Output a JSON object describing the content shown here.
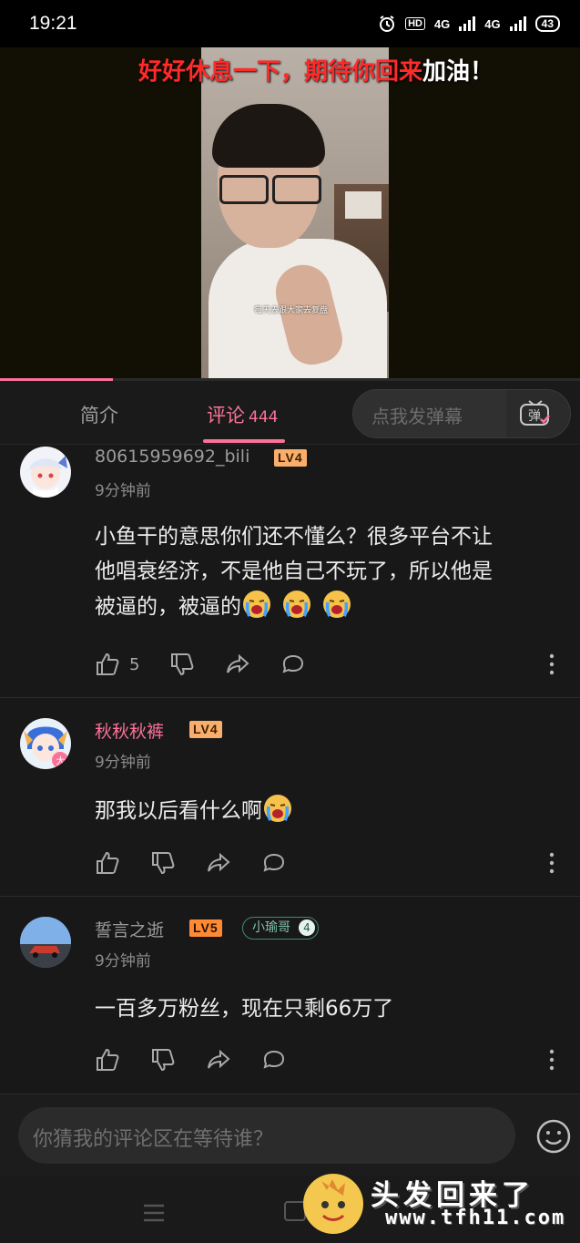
{
  "status_bar": {
    "time": "19:21",
    "hd": "HD",
    "net1": "4G",
    "net2": "4G",
    "battery": "43"
  },
  "video": {
    "danmaku_red": "好好休息一下，期待你回来",
    "danmaku_white": "加油！",
    "subtitle": "每天去跟大家去复盘",
    "progress": 0.195
  },
  "tabs": {
    "intro": "简介",
    "comments": "评论",
    "comment_count": "444",
    "danmaku_placeholder": "点我发弹幕",
    "danmaku_toggle_label": "弹"
  },
  "comments": [
    {
      "username": "80615959692_bili",
      "level": "LV4",
      "time": "9分钟前",
      "text_lines": [
        "小鱼干的意思你们还不懂么？很多平台不让",
        "他唱衰经济，不是他自己不玩了，所以他是",
        "被逼的，被逼的"
      ],
      "emojis": [
        "crying-emoji",
        "crying-emoji",
        "crying-emoji"
      ],
      "likes": "5"
    },
    {
      "username": "秋秋秋裤",
      "level": "LV4",
      "time": "9分钟前",
      "text_lines": [
        "那我以后看什么啊"
      ],
      "emojis": [
        "crying-emoji"
      ],
      "likes": ""
    },
    {
      "username": "誓言之逝",
      "level": "LV5",
      "fan_badge": "小瑜哥",
      "fan_level": "4",
      "time": "9分钟前",
      "text_lines": [
        "一百多万粉丝，现在只剩66万了"
      ],
      "likes": ""
    }
  ],
  "reply": {
    "placeholder": "你猜我的评论区在等待谁？"
  },
  "watermark": {
    "text": "头发回来了",
    "url": "www.tfh11.com"
  },
  "colors": {
    "accent": "#fb7299",
    "background": "#181818",
    "level4": "#f9ae6b",
    "level5": "#ff8a33",
    "fan_badge": "#3f8a73"
  }
}
